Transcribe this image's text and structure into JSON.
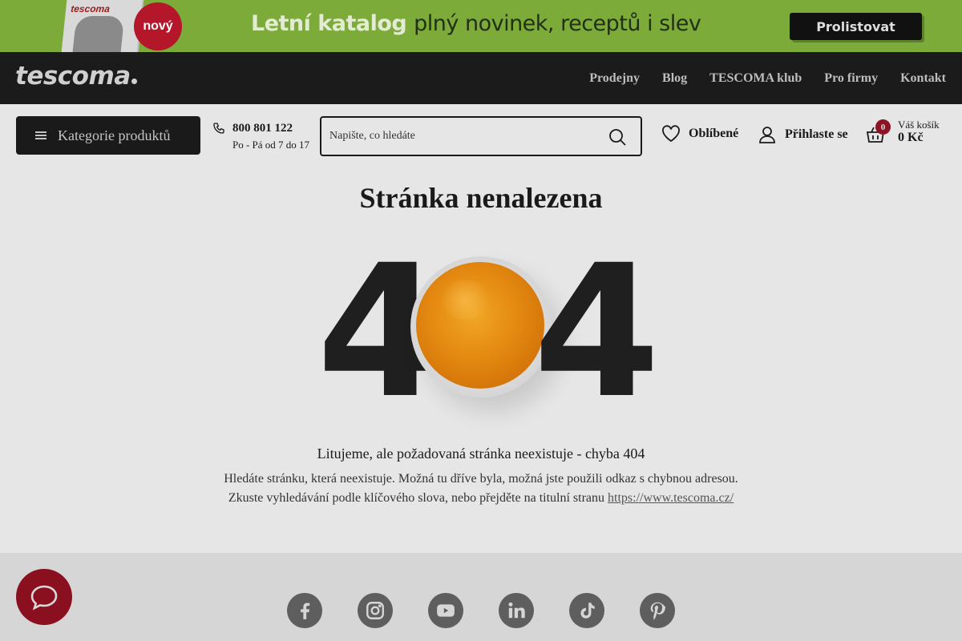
{
  "promo": {
    "magazine_title": "tescoma",
    "badge": "nový",
    "text_strong": "Letní katalog",
    "text_light": "plný novinek, receptů i slev",
    "button": "Prolistovat",
    "background_color": "#7cab3a"
  },
  "topbar": {
    "logo": "tescoma",
    "nav": [
      "Prodejny",
      "Blog",
      "TESCOMA klub",
      "Pro firmy",
      "Kontakt"
    ]
  },
  "header": {
    "categories_button": "Kategorie produktů",
    "phone_number": "800 801 122",
    "phone_hours": "Po - Pá od 7 do 17",
    "search_placeholder": "Napište, co hledáte",
    "favorites": "Oblíbené",
    "login": "Přihlaste se",
    "cart_count": "0",
    "cart_label": "Váš košík",
    "cart_total": "0 Kč",
    "accent_color": "#8a1424"
  },
  "main": {
    "title": "Stránka nenalezena",
    "digit_left": "4",
    "digit_right": "4",
    "message": "Litujeme, ale požadovaná stránka neexistuje - chyba 404",
    "description_line1": "Hledáte stránku, která neexistuje. Možná tu dříve byla, možná jste použili odkaz s chybnou adresou.",
    "description_line2": "Zkuste vyhledávání podle klíčového slova, nebo přejděte na titulní stranu",
    "home_link": "https://www.tescoma.cz/"
  },
  "footer": {
    "social_icons": [
      "facebook-icon",
      "instagram-icon",
      "youtube-icon",
      "linkedin-icon",
      "tiktok-icon",
      "pinterest-icon"
    ]
  },
  "chat": {
    "icon": "chat-bubble-icon",
    "color": "#8a1020"
  }
}
